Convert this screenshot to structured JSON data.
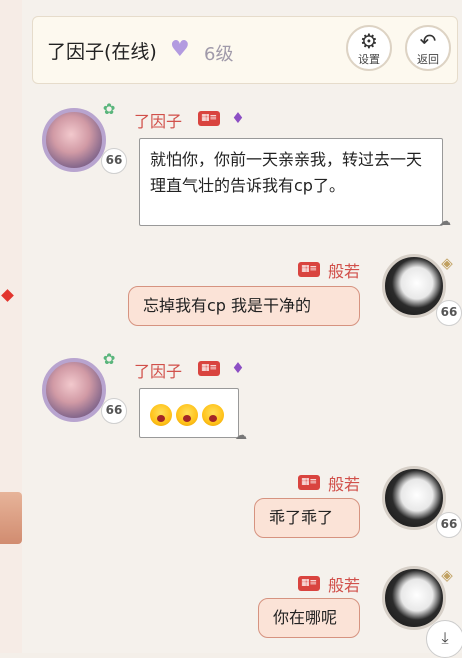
{
  "header": {
    "title": "了因子(在线)",
    "level": "6级",
    "settings_label": "设置",
    "back_label": "返回"
  },
  "messages": [
    {
      "side": "left",
      "name": "了因子",
      "level_badge": "66",
      "text": "就怕你，你前一天亲亲我，转过去一天理直气壮的告诉我有cp了。"
    },
    {
      "side": "right",
      "name": "般若",
      "level_badge": "66",
      "text": "忘掉我有cp 我是干净的"
    },
    {
      "side": "left",
      "name": "了因子",
      "level_badge": "66",
      "text": ""
    },
    {
      "side": "right",
      "name": "般若",
      "level_badge": "66",
      "text": "乖了乖了"
    },
    {
      "side": "right",
      "name": "般若",
      "level_badge": "66",
      "text": "你在哪呢"
    }
  ],
  "colors": {
    "accent_red": "#d1504a",
    "bubble_right": "#fbe3d7",
    "level_heart": "#b39be0"
  },
  "icons": {
    "settings": "gear-icon",
    "back": "back-arrow-icon",
    "scroll": "scroll-down-icon",
    "card": "id-card-icon",
    "gem": "gem-icon"
  }
}
